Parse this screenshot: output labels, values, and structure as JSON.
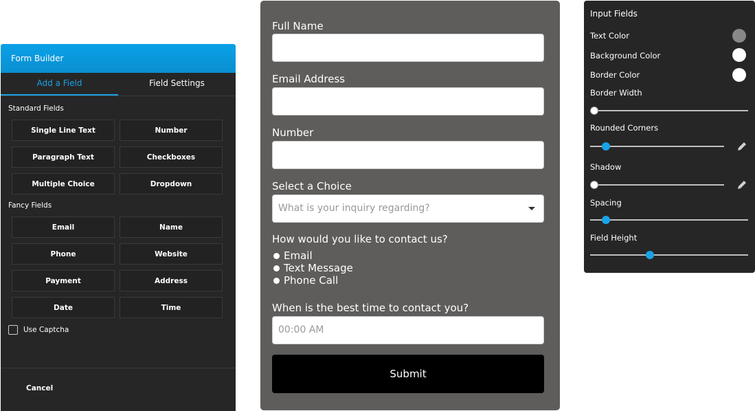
{
  "builder": {
    "title": "Form Builder",
    "tabs": [
      {
        "label": "Add a Field",
        "active": true
      },
      {
        "label": "Field Settings",
        "active": false
      }
    ],
    "standard_label": "Standard Fields",
    "standard_fields": [
      "Single Line Text",
      "Number",
      "Paragraph Text",
      "Checkboxes",
      "Multiple Choice",
      "Dropdown"
    ],
    "fancy_label": "Fancy Fields",
    "fancy_fields": [
      "Email",
      "Name",
      "Phone",
      "Website",
      "Payment",
      "Address",
      "Date",
      "Time"
    ],
    "captcha_label": "Use Captcha",
    "captcha_checked": false,
    "cancel_label": "Cancel"
  },
  "form": {
    "full_name_label": "Full Name",
    "full_name_value": "",
    "email_label": "Email Address",
    "email_value": "",
    "number_label": "Number",
    "number_value": "",
    "choice_label": "Select a Choice",
    "choice_placeholder": "What is your inquiry regarding?",
    "contact_label": "How would you like to contact us?",
    "contact_options": [
      "Email",
      "Text Message",
      "Phone Call"
    ],
    "time_label": "When is the best time to contact you?",
    "time_placeholder": "00:00 AM",
    "submit_label": "Submit"
  },
  "props": {
    "title": "Input Fields",
    "text_color_label": "Text Color",
    "text_color": "#888888",
    "background_color_label": "Background Color",
    "background_color": "#ffffff",
    "border_color_label": "Border Color",
    "border_color": "#ffffff",
    "border_width_label": "Border Width",
    "border_width_value": 0,
    "rounded_corners_label": "Rounded Corners",
    "rounded_corners_value": 0.12,
    "shadow_label": "Shadow",
    "shadow_value": 0,
    "spacing_label": "Spacing",
    "spacing_value": 0.1,
    "field_height_label": "Field Height",
    "field_height_value": 0.38
  },
  "colors": {
    "accent": "#1aa3e6",
    "header_gradient_top": "#0aa1e8",
    "panel_bg": "#262626",
    "preview_bg": "#5e5d5b"
  }
}
